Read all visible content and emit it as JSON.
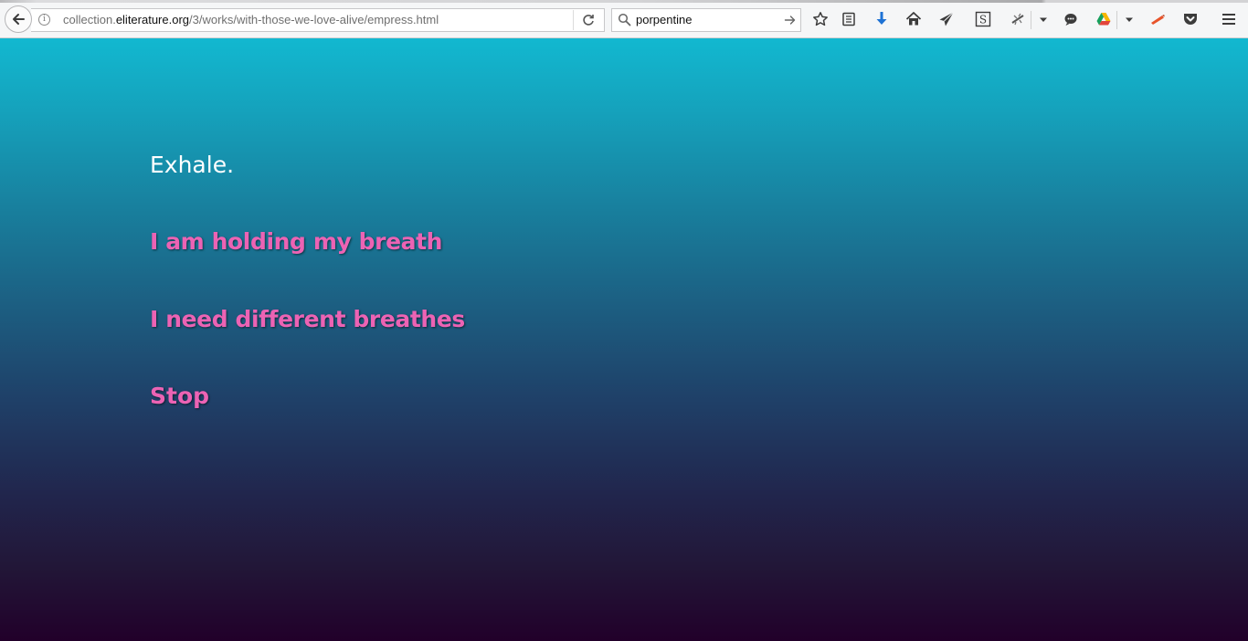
{
  "browser": {
    "url": {
      "prefix": "collection.",
      "domain": "eliterature.org",
      "path": "/3/works/with-those-we-love-alive/empress.html"
    },
    "search": {
      "value": "porpentine"
    }
  },
  "story": {
    "text": "Exhale.",
    "choices": [
      {
        "label": "I am holding my breath"
      },
      {
        "label": "I need different breathes"
      },
      {
        "label": "Stop"
      }
    ]
  },
  "colors": {
    "choice_link": "#ec63b4",
    "text": "#ffffff",
    "gradient_top": "#12b8d0",
    "gradient_bottom": "#22002a"
  }
}
